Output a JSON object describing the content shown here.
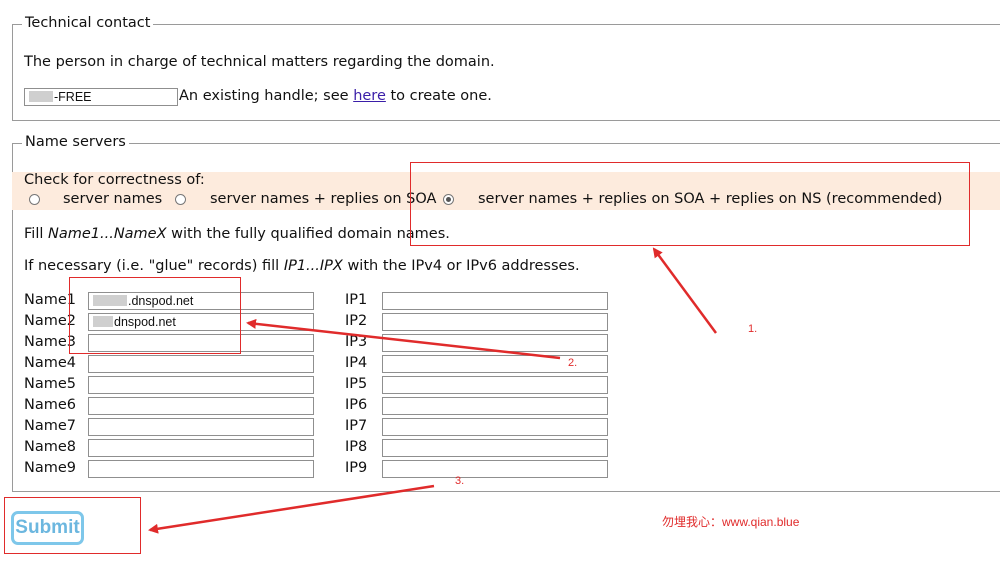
{
  "technical_contact": {
    "legend": "Technical contact",
    "description": "The person in charge of technical matters regarding the domain.",
    "handle_value": "-FREE",
    "handle_hint_before": "An existing handle; see ",
    "handle_link": "here",
    "handle_hint_after": " to create one."
  },
  "name_servers": {
    "legend": "Name servers",
    "check_label": "Check for correctness of:",
    "options": [
      {
        "label": "server names",
        "checked": false
      },
      {
        "label": "server names + replies on SOA",
        "checked": false
      },
      {
        "label": "server names + replies on SOA + replies on NS (recommended)",
        "checked": true
      }
    ],
    "fill_prefix": "Fill ",
    "fill_italic": "Name1...NameX",
    "fill_suffix": " with the fully qualified domain names.",
    "glue_prefix": "If necessary (i.e. \"glue\" records) fill ",
    "glue_italic": "IP1...IPX",
    "glue_suffix": " with the IPv4 or IPv6 addresses.",
    "rows": [
      {
        "name_label": "Name1",
        "name_value": ".dnspod.net",
        "ip_label": "IP1",
        "ip_value": ""
      },
      {
        "name_label": "Name2",
        "name_value": "dnspod.net",
        "ip_label": "IP2",
        "ip_value": ""
      },
      {
        "name_label": "Name3",
        "name_value": "",
        "ip_label": "IP3",
        "ip_value": ""
      },
      {
        "name_label": "Name4",
        "name_value": "",
        "ip_label": "IP4",
        "ip_value": ""
      },
      {
        "name_label": "Name5",
        "name_value": "",
        "ip_label": "IP5",
        "ip_value": ""
      },
      {
        "name_label": "Name6",
        "name_value": "",
        "ip_label": "IP6",
        "ip_value": ""
      },
      {
        "name_label": "Name7",
        "name_value": "",
        "ip_label": "IP7",
        "ip_value": ""
      },
      {
        "name_label": "Name8",
        "name_value": "",
        "ip_label": "IP8",
        "ip_value": ""
      },
      {
        "name_label": "Name9",
        "name_value": "",
        "ip_label": "IP9",
        "ip_value": ""
      }
    ]
  },
  "submit_label": "Submit",
  "annotations": {
    "step1": "1.",
    "step2": "2.",
    "step3": "3.",
    "watermark": "勿埋我心：www.qian.blue"
  },
  "colors": {
    "annotation_red": "#e02b2b",
    "submit_blue": "#7ec7ea",
    "soa_band": "#fdebdd",
    "link": "#3a1ea8"
  }
}
